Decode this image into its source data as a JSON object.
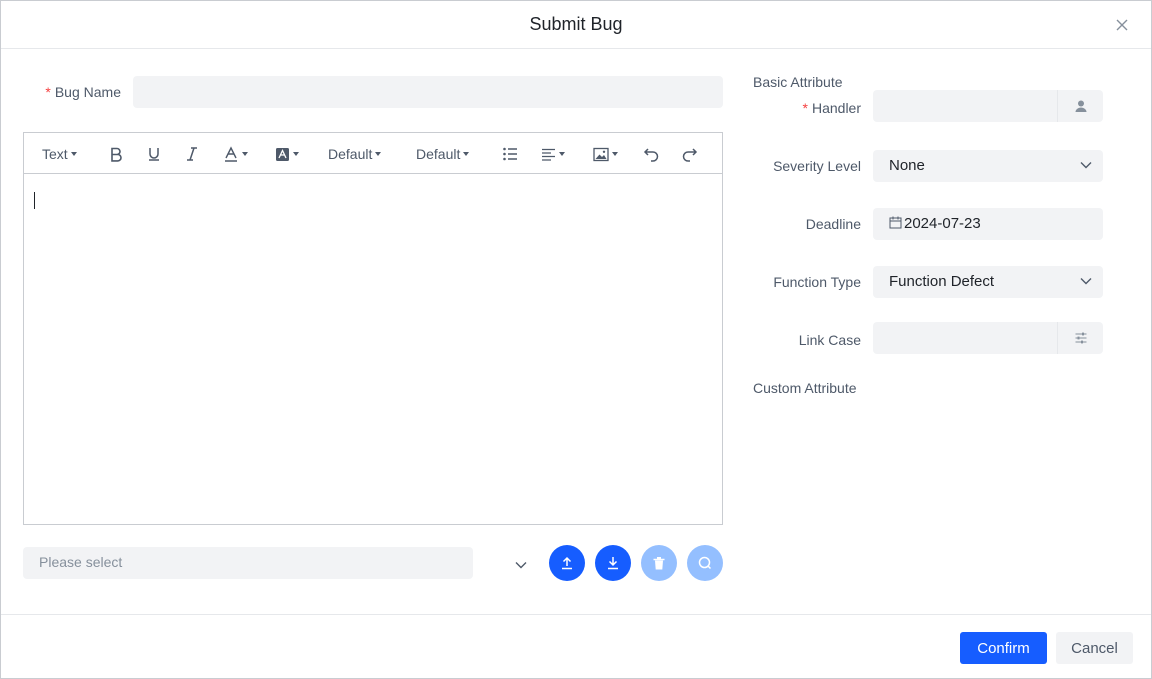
{
  "dialog": {
    "title": "Submit Bug"
  },
  "form": {
    "bug_name": {
      "label": "Bug Name",
      "required_mark": "*",
      "value": ""
    },
    "editor": {
      "toolbar": {
        "text_style": "Text",
        "font_family": "Default",
        "font_size": "Default"
      },
      "content": ""
    },
    "attachment_select": {
      "placeholder": "Please select"
    }
  },
  "sidebar": {
    "basic_heading": "Basic Attribute",
    "handler": {
      "label": "Handler",
      "required_mark": "*",
      "value": ""
    },
    "severity": {
      "label": "Severity Level",
      "value": "None"
    },
    "deadline": {
      "label": "Deadline",
      "value": "2024-07-23"
    },
    "function_type": {
      "label": "Function Type",
      "value": "Function Defect"
    },
    "link_case": {
      "label": "Link Case",
      "value": ""
    },
    "custom_heading": "Custom Attribute"
  },
  "footer": {
    "confirm_label": "Confirm",
    "cancel_label": "Cancel"
  },
  "colors": {
    "primary": "#165dff",
    "primary_disabled": "#94bfff",
    "required": "#f53f3f",
    "input_bg": "#f2f3f5"
  },
  "icons": [
    "close-icon",
    "bold-icon",
    "underline-icon",
    "italic-icon",
    "font-color-icon",
    "highlight-icon",
    "bullet-list-icon",
    "align-icon",
    "image-icon",
    "undo-icon",
    "redo-icon",
    "user-icon",
    "calendar-icon",
    "chevron-down-icon",
    "settings-sliders-icon",
    "upload-icon",
    "download-icon",
    "delete-icon",
    "search-icon"
  ]
}
